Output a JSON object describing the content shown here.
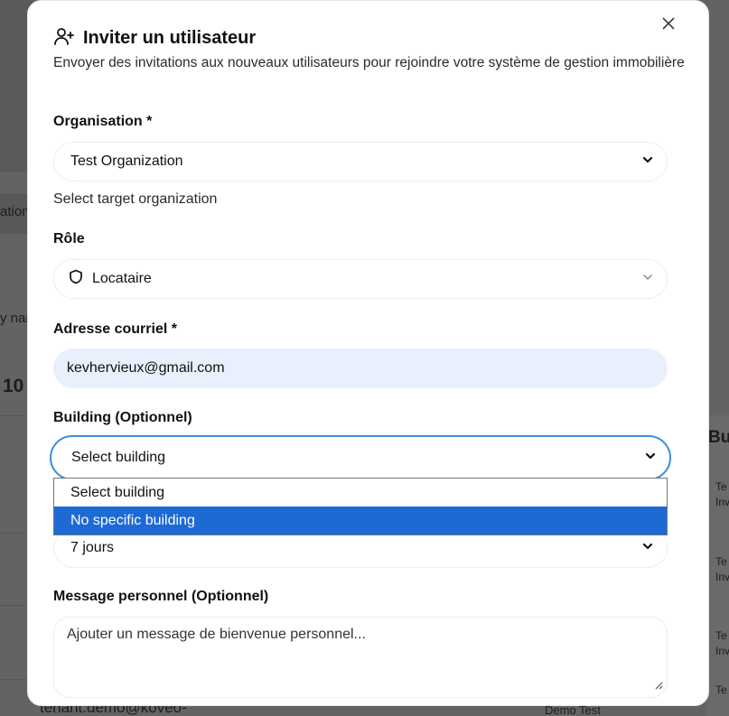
{
  "background": {
    "left_fragments": [
      "ation",
      "y nar",
      "10",
      "tenant.demo@koveo-"
    ],
    "right_header": "Bu",
    "right_rows": [
      [
        "Te",
        "Inv"
      ],
      [
        "Te",
        "Inv"
      ],
      [
        "Te",
        "Inv"
      ],
      [
        "Te",
        "Inv"
      ]
    ],
    "bottom_name": "Demo Test"
  },
  "modal": {
    "title": "Inviter un utilisateur",
    "title_icon": "user-plus-icon",
    "description": "Envoyer des invitations aux nouveaux utilisateurs pour rejoindre votre système de gestion immobilière",
    "close_icon": "close-icon"
  },
  "form": {
    "organisation": {
      "label": "Organisation *",
      "value": "Test Organization",
      "hint": "Select target organization"
    },
    "role": {
      "label": "Rôle",
      "value": "Locataire",
      "icon": "shield-icon"
    },
    "email": {
      "label": "Adresse courriel *",
      "value": "kevhervieux@gmail.com"
    },
    "building": {
      "label": "Building (Optionnel)",
      "value": "Select building",
      "options": [
        "Select building",
        "No specific building"
      ],
      "highlighted_option": "No specific building"
    },
    "expiry": {
      "value": "7 jours"
    },
    "message": {
      "label": "Message personnel (Optionnel)",
      "placeholder": "Ajouter un message de bienvenue personnel..."
    }
  },
  "colors": {
    "focus_ring": "#3b8fd9",
    "highlight": "#1d6ad5",
    "autofill_bg": "#e8f0fe"
  }
}
